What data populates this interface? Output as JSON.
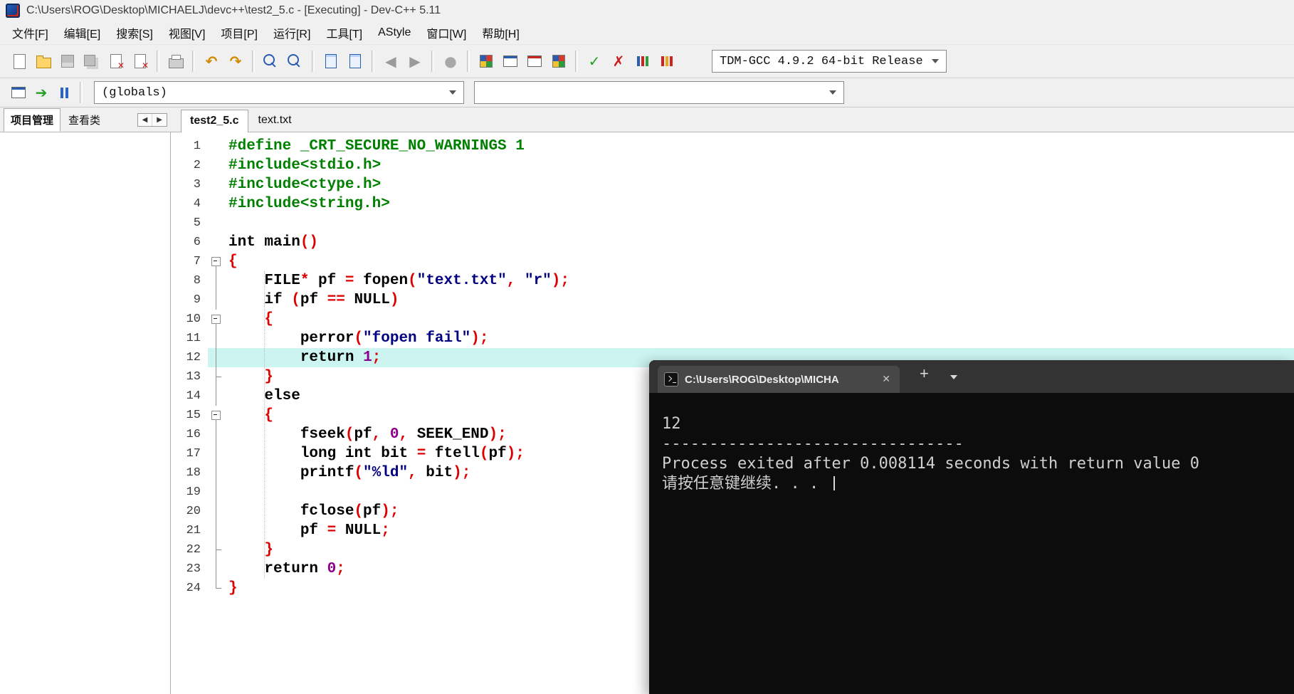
{
  "window": {
    "title": "C:\\Users\\ROG\\Desktop\\MICHAELJ\\devc++\\test2_5.c - [Executing] - Dev-C++ 5.11"
  },
  "menu": {
    "items": [
      {
        "id": "file",
        "label": "文件[F]"
      },
      {
        "id": "edit",
        "label": "编辑[E]"
      },
      {
        "id": "search",
        "label": "搜索[S]"
      },
      {
        "id": "view",
        "label": "视图[V]"
      },
      {
        "id": "project",
        "label": "项目[P]"
      },
      {
        "id": "run",
        "label": "运行[R]"
      },
      {
        "id": "tools",
        "label": "工具[T]"
      },
      {
        "id": "astyle",
        "label": "AStyle"
      },
      {
        "id": "window",
        "label": "窗口[W]"
      },
      {
        "id": "help",
        "label": "帮助[H]"
      }
    ]
  },
  "toolbar": {
    "groups": [
      [
        "new-file-icon",
        "open-file-icon",
        "save-icon",
        "save-all-icon",
        "close-file-icon",
        "close-all-icon"
      ],
      [
        "print-icon"
      ],
      [
        "undo-icon",
        "redo-icon"
      ],
      [
        "find-icon",
        "replace-icon"
      ],
      [
        "goto-line-icon",
        "bookmark-icon"
      ],
      [
        "back-icon",
        "forward-icon"
      ],
      [
        "abort-icon"
      ],
      [
        "new-project-icon",
        "remove-project-icon",
        "project-options-icon",
        "package-manager-icon"
      ],
      [
        "compile-icon",
        "rebuild-icon",
        "profile-icon",
        "profile-analysis-icon"
      ]
    ],
    "compiler_select": {
      "value": "TDM-GCC 4.9.2 64-bit Release"
    }
  },
  "navbar": {
    "icons": [
      "goto-declaration-icon",
      "goto-implementation-icon",
      "pause-icon"
    ],
    "globals_select": {
      "value": "(globals)"
    },
    "members_select": {
      "value": ""
    }
  },
  "left_panel": {
    "tabs": [
      {
        "id": "project",
        "label": "项目管理",
        "active": true
      },
      {
        "id": "classes",
        "label": "查看类",
        "active": false
      }
    ]
  },
  "editor": {
    "tabs": [
      {
        "label": "test2_5.c",
        "active": true
      },
      {
        "label": "text.txt",
        "active": false
      }
    ],
    "highlight_line": 12,
    "lines": [
      {
        "n": 1,
        "fold": "",
        "segs": [
          [
            "pp",
            "#define _CRT_SECURE_NO_WARNINGS 1"
          ]
        ]
      },
      {
        "n": 2,
        "fold": "",
        "segs": [
          [
            "pp",
            "#include<stdio.h>"
          ]
        ]
      },
      {
        "n": 3,
        "fold": "",
        "segs": [
          [
            "pp",
            "#include<ctype.h>"
          ]
        ]
      },
      {
        "n": 4,
        "fold": "",
        "segs": [
          [
            "pp",
            "#include<string.h>"
          ]
        ]
      },
      {
        "n": 5,
        "fold": "",
        "segs": []
      },
      {
        "n": 6,
        "fold": "",
        "segs": [
          [
            "kw",
            "int"
          ],
          [
            "idf",
            " main"
          ],
          [
            "sym",
            "()"
          ]
        ]
      },
      {
        "n": 7,
        "fold": "box",
        "segs": [
          [
            "sym",
            "{"
          ]
        ]
      },
      {
        "n": 8,
        "fold": "v",
        "segs": [
          [
            "idf",
            "    "
          ],
          [
            "kw",
            "FILE"
          ],
          [
            "sym",
            "*"
          ],
          [
            "idf",
            " pf "
          ],
          [
            "sym",
            "="
          ],
          [
            "idf",
            " fopen"
          ],
          [
            "sym",
            "("
          ],
          [
            "str",
            "\"text.txt\""
          ],
          [
            "sym",
            ","
          ],
          [
            "idf",
            " "
          ],
          [
            "str",
            "\"r\""
          ],
          [
            "sym",
            ");"
          ]
        ]
      },
      {
        "n": 9,
        "fold": "v",
        "segs": [
          [
            "idf",
            "    "
          ],
          [
            "kw",
            "if"
          ],
          [
            "idf",
            " "
          ],
          [
            "sym",
            "("
          ],
          [
            "idf",
            "pf "
          ],
          [
            "sym",
            "=="
          ],
          [
            "idf",
            " "
          ],
          [
            "kw",
            "NULL"
          ],
          [
            "sym",
            ")"
          ]
        ]
      },
      {
        "n": 10,
        "fold": "box",
        "segs": [
          [
            "idf",
            "    "
          ],
          [
            "sym",
            "{"
          ]
        ]
      },
      {
        "n": 11,
        "fold": "v",
        "segs": [
          [
            "idf",
            "        perror"
          ],
          [
            "sym",
            "("
          ],
          [
            "str",
            "\"fopen fail\""
          ],
          [
            "sym",
            ");"
          ]
        ]
      },
      {
        "n": 12,
        "fold": "v",
        "segs": [
          [
            "idf",
            "        "
          ],
          [
            "kw",
            "return"
          ],
          [
            "idf",
            " "
          ],
          [
            "num",
            "1"
          ],
          [
            "sym",
            ";"
          ]
        ]
      },
      {
        "n": 13,
        "fold": "t",
        "segs": [
          [
            "idf",
            "    "
          ],
          [
            "sym",
            "}"
          ]
        ]
      },
      {
        "n": 14,
        "fold": "v",
        "segs": [
          [
            "idf",
            "    "
          ],
          [
            "kw",
            "else"
          ]
        ]
      },
      {
        "n": 15,
        "fold": "box",
        "segs": [
          [
            "idf",
            "    "
          ],
          [
            "sym",
            "{"
          ]
        ]
      },
      {
        "n": 16,
        "fold": "v",
        "segs": [
          [
            "idf",
            "        fseek"
          ],
          [
            "sym",
            "("
          ],
          [
            "idf",
            "pf"
          ],
          [
            "sym",
            ","
          ],
          [
            "idf",
            " "
          ],
          [
            "num",
            "0"
          ],
          [
            "sym",
            ","
          ],
          [
            "idf",
            " SEEK_END"
          ],
          [
            "sym",
            ");"
          ]
        ]
      },
      {
        "n": 17,
        "fold": "v",
        "segs": [
          [
            "idf",
            "        "
          ],
          [
            "kw",
            "long"
          ],
          [
            "idf",
            " "
          ],
          [
            "kw",
            "int"
          ],
          [
            "idf",
            " bit "
          ],
          [
            "sym",
            "="
          ],
          [
            "idf",
            " ftell"
          ],
          [
            "sym",
            "("
          ],
          [
            "idf",
            "pf"
          ],
          [
            "sym",
            ");"
          ]
        ]
      },
      {
        "n": 18,
        "fold": "v",
        "segs": [
          [
            "idf",
            "        printf"
          ],
          [
            "sym",
            "("
          ],
          [
            "str",
            "\"%ld\""
          ],
          [
            "sym",
            ","
          ],
          [
            "idf",
            " bit"
          ],
          [
            "sym",
            ");"
          ]
        ]
      },
      {
        "n": 19,
        "fold": "v",
        "segs": []
      },
      {
        "n": 20,
        "fold": "v",
        "segs": [
          [
            "idf",
            "        fclose"
          ],
          [
            "sym",
            "("
          ],
          [
            "idf",
            "pf"
          ],
          [
            "sym",
            ");"
          ]
        ]
      },
      {
        "n": 21,
        "fold": "v",
        "segs": [
          [
            "idf",
            "        pf "
          ],
          [
            "sym",
            "="
          ],
          [
            "idf",
            " "
          ],
          [
            "kw",
            "NULL"
          ],
          [
            "sym",
            ";"
          ]
        ]
      },
      {
        "n": 22,
        "fold": "t",
        "segs": [
          [
            "idf",
            "    "
          ],
          [
            "sym",
            "}"
          ]
        ]
      },
      {
        "n": 23,
        "fold": "v",
        "segs": [
          [
            "idf",
            "    "
          ],
          [
            "kw",
            "return"
          ],
          [
            "idf",
            " "
          ],
          [
            "num",
            "0"
          ],
          [
            "sym",
            ";"
          ]
        ]
      },
      {
        "n": 24,
        "fold": "L",
        "segs": [
          [
            "sym",
            "}"
          ]
        ]
      }
    ]
  },
  "terminal": {
    "tab_title": "C:\\Users\\ROG\\Desktop\\MICHA",
    "lines": [
      "12",
      "--------------------------------",
      "Process exited after 0.008114 seconds with return value 0",
      "请按任意键继续. . . "
    ],
    "show_cursor": true
  },
  "colors": {
    "preprocessor": "#008000",
    "keyword": "#000000",
    "string": "#000080",
    "number": "#8b008b",
    "symbol": "#dd0000",
    "line_highlight": "#ccf4f1",
    "terminal_bg": "#0c0c0c",
    "terminal_fg": "#cfcfcf"
  }
}
